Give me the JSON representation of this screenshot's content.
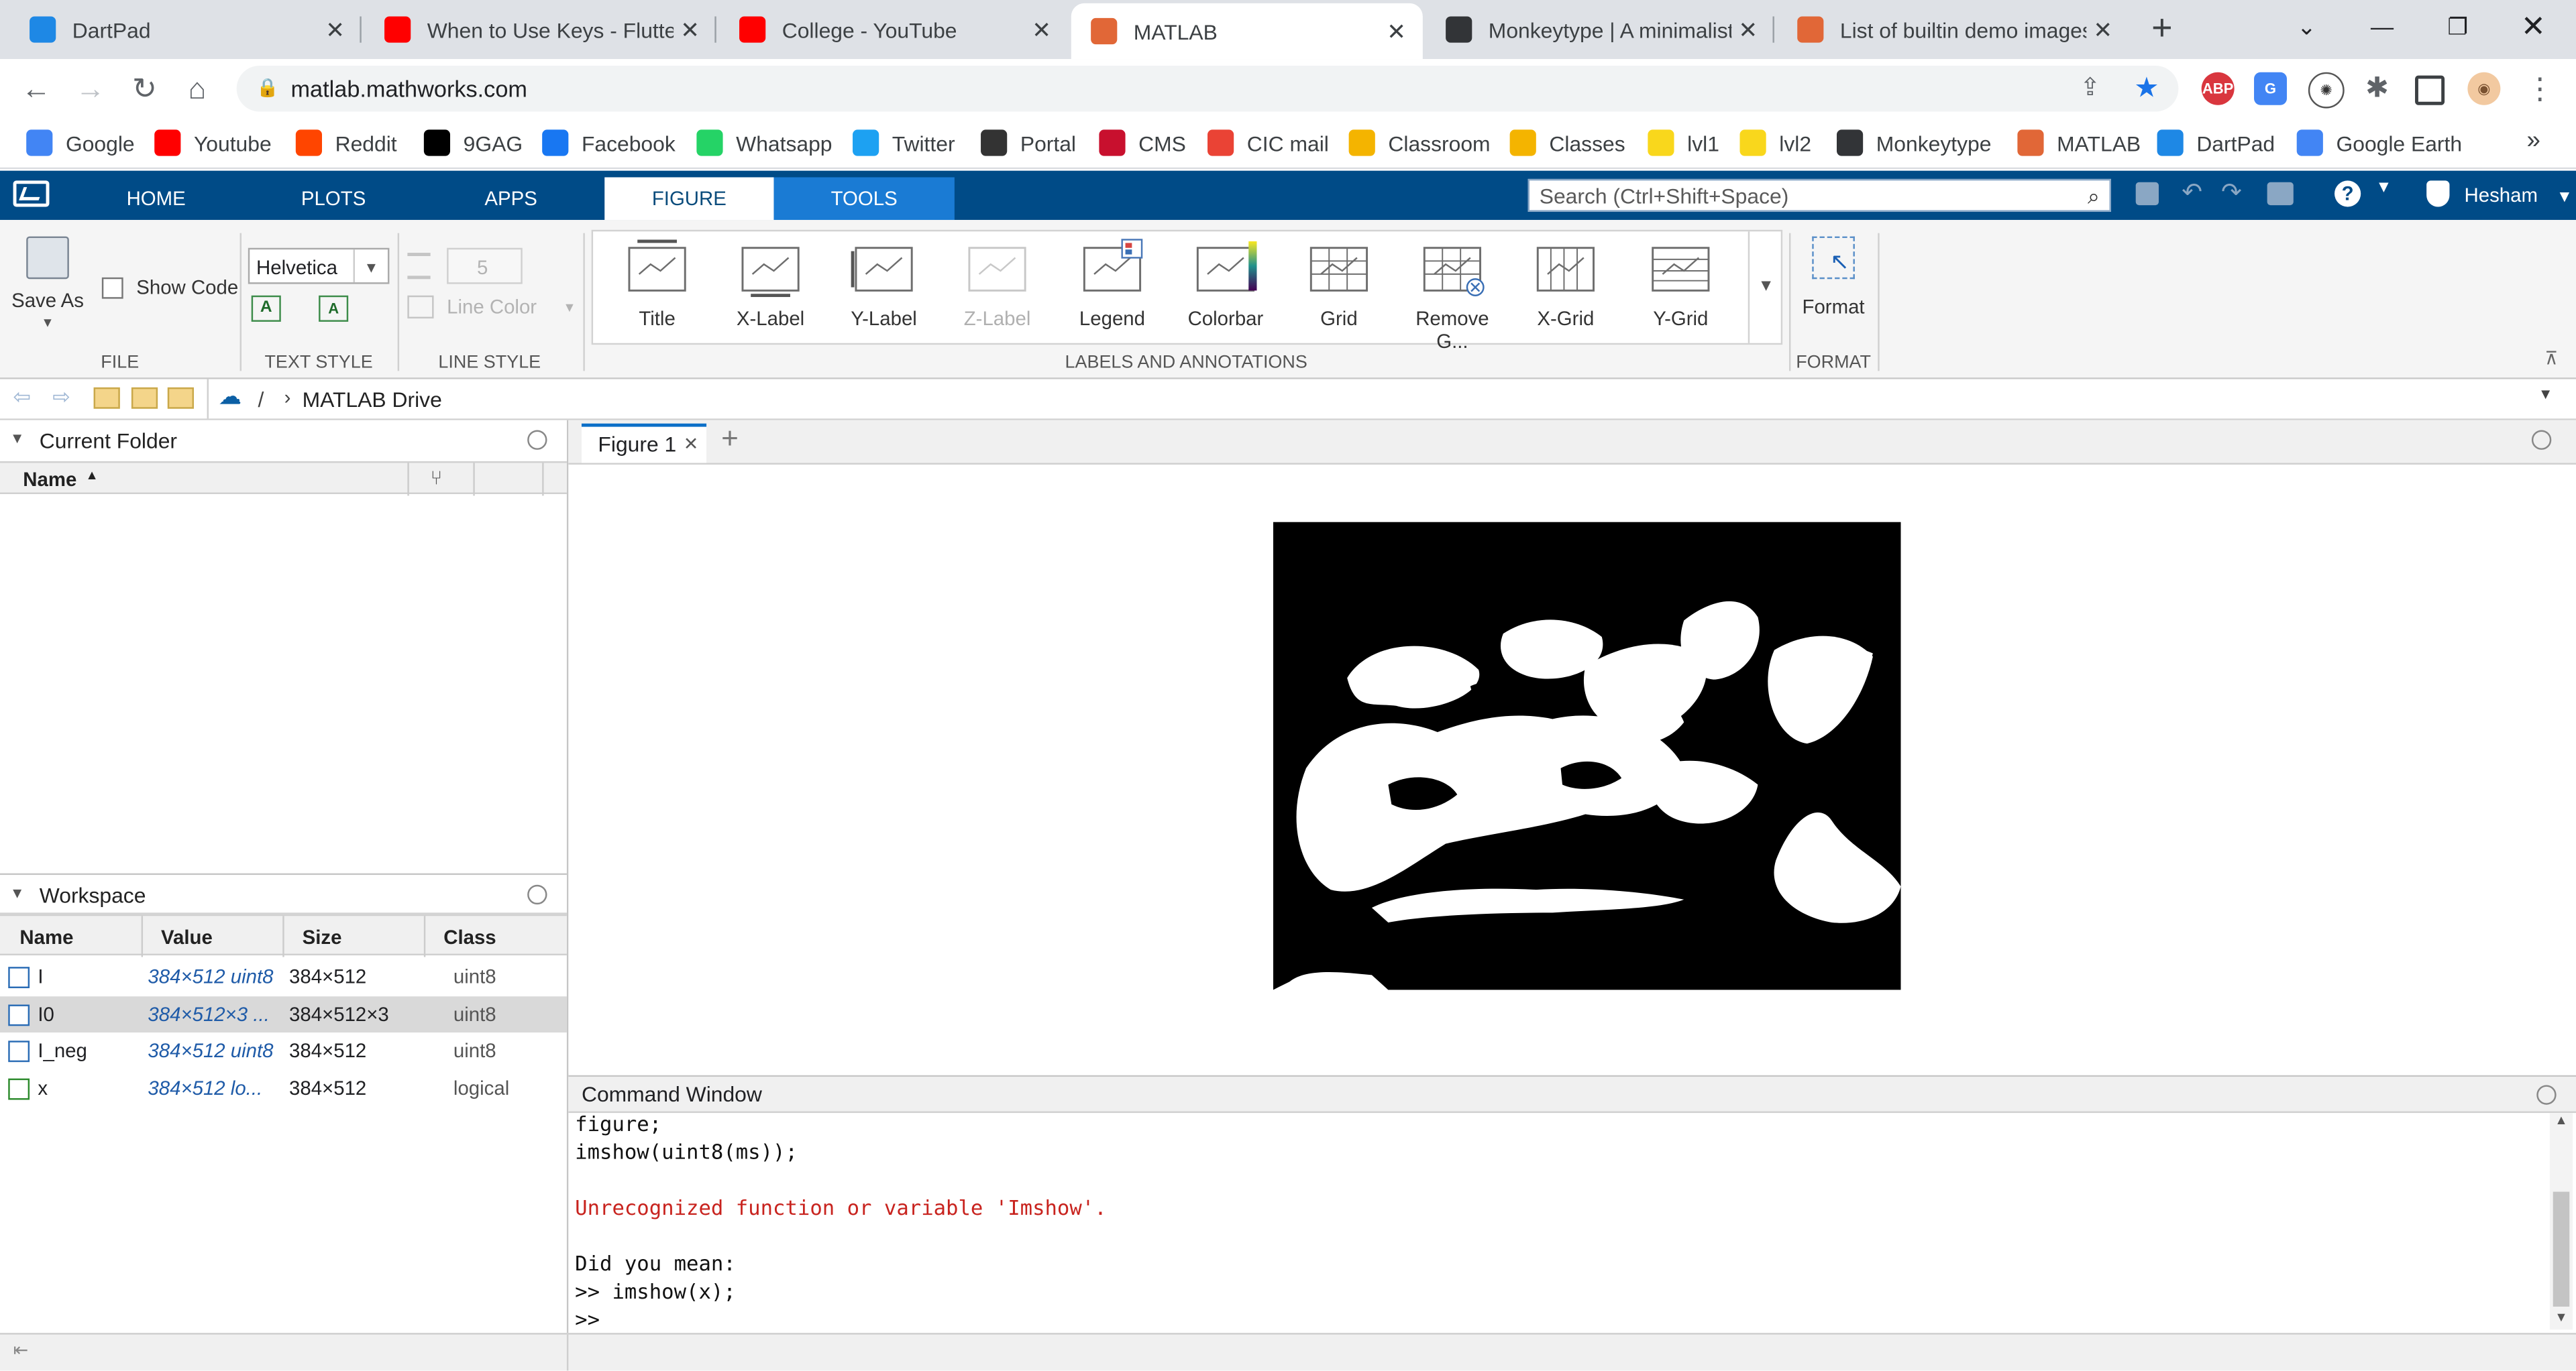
{
  "browser": {
    "tabs": [
      {
        "label": "DartPad",
        "icon": "dart-icon",
        "color": "#1e88e5",
        "active": false
      },
      {
        "label": "When to Use Keys - Flutter",
        "icon": "youtube-icon",
        "color": "#ff0000",
        "active": false
      },
      {
        "label": "College - YouTube",
        "icon": "youtube-icon",
        "color": "#ff0000",
        "active": false
      },
      {
        "label": "MATLAB",
        "icon": "matlab-icon",
        "color": "#e16737",
        "active": true
      },
      {
        "label": "Monkeytype | A minimalisti",
        "icon": "monkeytype-icon",
        "color": "#323437",
        "active": false
      },
      {
        "label": "List of builtin demo images",
        "icon": "matlab-icon",
        "color": "#e16737",
        "active": false
      }
    ],
    "new_tab": "+",
    "url": "matlab.mathworks.com",
    "bookmarks": [
      {
        "label": "Google",
        "color": "#4285f4"
      },
      {
        "label": "Youtube",
        "color": "#ff0000"
      },
      {
        "label": "Reddit",
        "color": "#ff4500"
      },
      {
        "label": "9GAG",
        "color": "#000000"
      },
      {
        "label": "Facebook",
        "color": "#1877f2"
      },
      {
        "label": "Whatsapp",
        "color": "#25d366"
      },
      {
        "label": "Twitter",
        "color": "#1da1f2"
      },
      {
        "label": "Portal",
        "color": "#333333"
      },
      {
        "label": "CMS",
        "color": "#c8102e"
      },
      {
        "label": "CIC mail",
        "color": "#ea4335"
      },
      {
        "label": "Classroom",
        "color": "#f4b400"
      },
      {
        "label": "Classes",
        "color": "#f4b400"
      },
      {
        "label": "lvl1",
        "color": "#f9d71c"
      },
      {
        "label": "lvl2",
        "color": "#f9d71c"
      },
      {
        "label": "Monkeytype",
        "color": "#323437"
      },
      {
        "label": "MATLAB",
        "color": "#e16737"
      },
      {
        "label": "DartPad",
        "color": "#1e88e5"
      },
      {
        "label": "Google Earth",
        "color": "#4285f4"
      }
    ],
    "bookmarks_more": "»"
  },
  "matlab": {
    "tabs": [
      "HOME",
      "PLOTS",
      "APPS",
      "FIGURE",
      "TOOLS"
    ],
    "search_placeholder": "Search (Ctrl+Shift+Space)",
    "user": "Hesham",
    "ribbon": {
      "save_as": "Save As",
      "show_code": "Show Code",
      "file_label": "FILE",
      "font": "Helvetica",
      "text_style_label": "TEXT STYLE",
      "line_width": "5",
      "line_color": "Line Color",
      "line_style_label": "LINE STYLE",
      "annotations": [
        {
          "label": "Title",
          "enabled": true
        },
        {
          "label": "X-Label",
          "enabled": true
        },
        {
          "label": "Y-Label",
          "enabled": true
        },
        {
          "label": "Z-Label",
          "enabled": false
        },
        {
          "label": "Legend",
          "enabled": true
        },
        {
          "label": "Colorbar",
          "enabled": true
        },
        {
          "label": "Grid",
          "enabled": true
        },
        {
          "label": "Remove G...",
          "enabled": true
        },
        {
          "label": "X-Grid",
          "enabled": true
        },
        {
          "label": "Y-Grid",
          "enabled": true
        }
      ],
      "annotations_label": "LABELS AND ANNOTATIONS",
      "format": "Format",
      "format_label": "FORMAT"
    },
    "path": {
      "root": "/",
      "folder": "MATLAB Drive"
    },
    "current_folder": {
      "title": "Current Folder",
      "col_name": "Name"
    },
    "workspace": {
      "title": "Workspace",
      "columns": [
        "Name",
        "Value",
        "Size",
        "Class"
      ],
      "rows": [
        {
          "name": "I",
          "value": "384×512 uint8",
          "size": "384×512",
          "class": "uint8",
          "selected": false,
          "logical": false
        },
        {
          "name": "I0",
          "value": "384×512×3 ...",
          "size": "384×512×3",
          "class": "uint8",
          "selected": true,
          "logical": false
        },
        {
          "name": "I_neg",
          "value": "384×512 uint8",
          "size": "384×512",
          "class": "uint8",
          "selected": false,
          "logical": false
        },
        {
          "name": "x",
          "value": "384×512 lo...",
          "size": "384×512",
          "class": "logical",
          "selected": false,
          "logical": true
        }
      ]
    },
    "figure_tab": "Figure 1",
    "command_window": {
      "title": "Command Window",
      "lines": [
        {
          "text": "figure;",
          "error": false
        },
        {
          "text": "imshow(uint8(ms));",
          "error": false
        },
        {
          "text": "",
          "error": false
        },
        {
          "text": "Unrecognized function or variable 'Imshow'.",
          "error": true
        },
        {
          "text": "",
          "error": false
        },
        {
          "text": "Did you mean:",
          "error": false
        },
        {
          "text": ">> imshow(x);",
          "error": false
        },
        {
          "text": ">>",
          "error": false
        }
      ]
    }
  }
}
